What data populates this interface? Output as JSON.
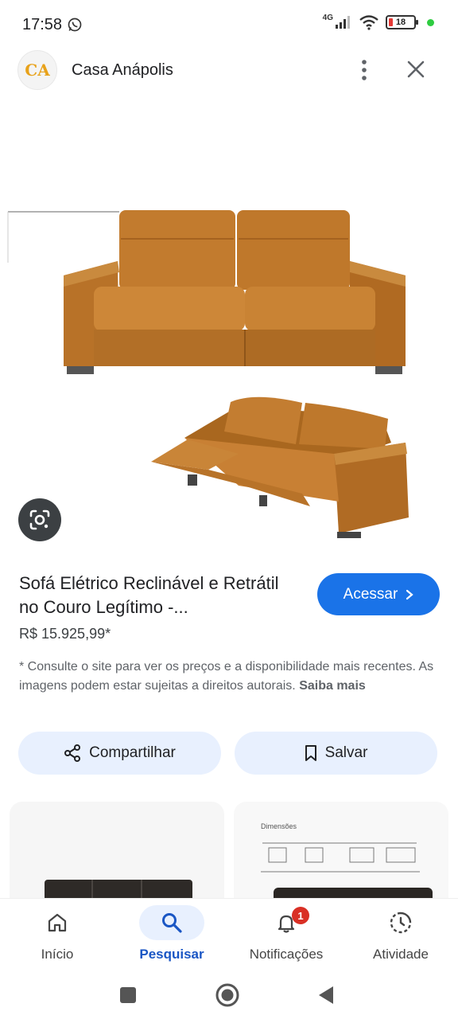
{
  "status_bar": {
    "time": "17:58",
    "network": "4G",
    "battery": "18"
  },
  "header": {
    "logo_text": "CA",
    "site_name": "Casa Anápolis"
  },
  "product": {
    "title": "Sofá Elétrico Reclinável e Retrátil no Couro Legítimo -...",
    "price": "R$ 15.925,99*",
    "visit_label": "Acessar",
    "disclaimer": "* Consulte o site para ver os preços e a disponibilidade mais recentes. As imagens podem estar sujeitas a direitos autorais.",
    "learn_more": "Saiba mais"
  },
  "actions": {
    "share_label": "Compartilhar",
    "save_label": "Salvar"
  },
  "related": {
    "card2_heading": "Dimensões"
  },
  "bottom_nav": {
    "items": [
      {
        "label": "Início",
        "icon": "home-icon"
      },
      {
        "label": "Pesquisar",
        "icon": "search-icon"
      },
      {
        "label": "Notificações",
        "icon": "bell-icon",
        "badge": "1"
      },
      {
        "label": "Atividade",
        "icon": "activity-icon"
      }
    ],
    "active": "Pesquisar"
  },
  "colors": {
    "accent": "#1a73e8",
    "chip_bg": "#e8f0fe",
    "leather": "#c07a2c",
    "badge": "#d93025"
  }
}
